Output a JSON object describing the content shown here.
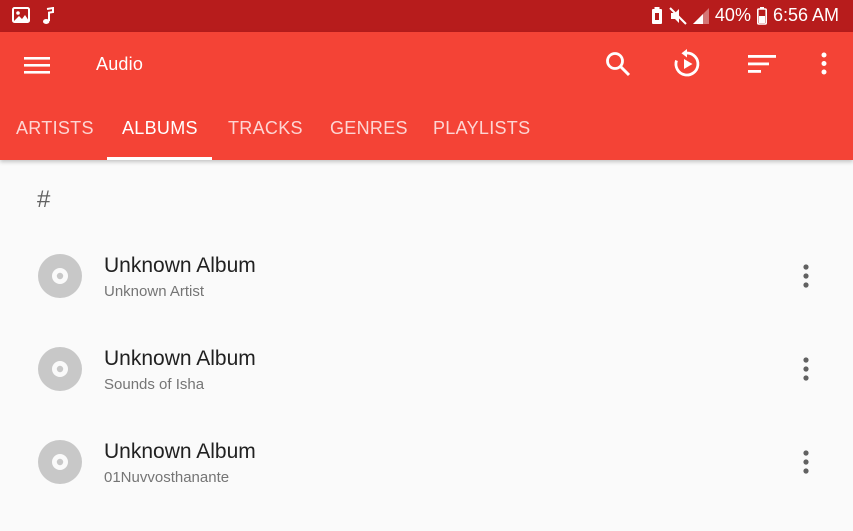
{
  "status_bar": {
    "battery_percent": "40%",
    "time": "6:56 AM",
    "left_icons": [
      "gallery-icon",
      "music-note-icon"
    ],
    "right_icons": [
      "battery-saver-icon",
      "mute-icon",
      "signal-icon",
      "battery-icon"
    ]
  },
  "app_bar": {
    "title": "Audio",
    "actions": [
      "search-icon",
      "replay-icon",
      "sort-icon",
      "overflow-menu-icon"
    ],
    "color": "#f44336",
    "status_color": "#b71c1c"
  },
  "tabs": [
    {
      "label": "ARTISTS",
      "active": false
    },
    {
      "label": "ALBUMS",
      "active": true
    },
    {
      "label": "TRACKS",
      "active": false
    },
    {
      "label": "GENRES",
      "active": false
    },
    {
      "label": "PLAYLISTS",
      "active": false
    }
  ],
  "list": {
    "section_header": "#",
    "albums": [
      {
        "title": "Unknown Album",
        "subtitle": "Unknown Artist"
      },
      {
        "title": "Unknown Album",
        "subtitle": "Sounds of Isha"
      },
      {
        "title": "Unknown Album",
        "subtitle": "01Nuvvosthanante"
      }
    ]
  }
}
